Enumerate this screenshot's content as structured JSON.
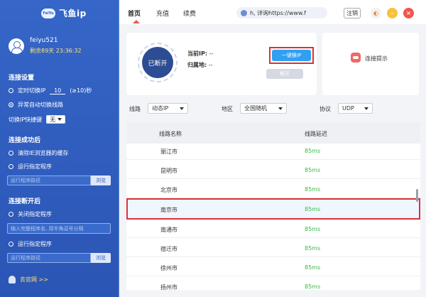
{
  "app": {
    "logo_mark": "FeiYu",
    "name": "飞鱼ip"
  },
  "user": {
    "name": "feiyu521",
    "remain": "剩余89天 23:36:32"
  },
  "sidebar": {
    "section_conn": "连接设置",
    "timed_switch_label": "定时切换IP",
    "timed_switch_value": "10",
    "timed_switch_unit": "(≥10)秒",
    "auto_switch_label": "异常自动切换线路",
    "hotkey_label": "切换IP快捷键",
    "hotkey_value": "无",
    "section_after_conn": "连接成功后",
    "clear_cache_label": "清除IE浏览器的缓存",
    "run_program_label": "运行指定程序",
    "program_path_placeholder": "运行程序路径",
    "browse_label": "浏览",
    "section_after_disconnect": "连接断开后",
    "close_program_label": "关闭指定程序",
    "program_name_placeholder": "输入完整程序名, 用半角逗号分隔",
    "run_program_label2": "运行指定程序",
    "program_path_placeholder2": "运行程序路径",
    "browse_label2": "浏览",
    "official_site": "去官网 >>"
  },
  "topbar": {
    "tabs": [
      "首页",
      "充值",
      "续费"
    ],
    "active_tab": "首页",
    "notice": "h, 详询https://www.f",
    "logout": "注销",
    "icons": [
      "skin-icon",
      "minimize-icon",
      "close-icon"
    ]
  },
  "status": {
    "state": "已断开",
    "ip_label": "当前IP:",
    "ip_value": "--",
    "location_label": "归属地:",
    "location_value": "--",
    "switch_button": "一键换IP",
    "disconnect_button": "断开"
  },
  "tips": {
    "label": "连接提示"
  },
  "filter": {
    "line_label": "线路",
    "line_value": "动态IP",
    "region_label": "地区",
    "region_value": "全国随机",
    "protocol_label": "协议",
    "protocol_value": "UDP"
  },
  "table": {
    "headers": [
      "线路名称",
      "线路延迟"
    ],
    "rows": [
      {
        "name": "丽江市",
        "latency": "85ms"
      },
      {
        "name": "昆明市",
        "latency": "85ms"
      },
      {
        "name": "北京市",
        "latency": "85ms"
      },
      {
        "name": "南京市",
        "latency": "85ms"
      },
      {
        "name": "南通市",
        "latency": "85ms"
      },
      {
        "name": "宿迁市",
        "latency": "85ms"
      },
      {
        "name": "徐州市",
        "latency": "85ms"
      },
      {
        "name": "扬州市",
        "latency": "85ms"
      }
    ],
    "selected_row": "南京市"
  },
  "colors": {
    "sidebar": "#3566c8",
    "accent": "#31a0f2",
    "highlight": "#d9333a",
    "latency": "#3db54a",
    "remain": "#ffe27a"
  }
}
